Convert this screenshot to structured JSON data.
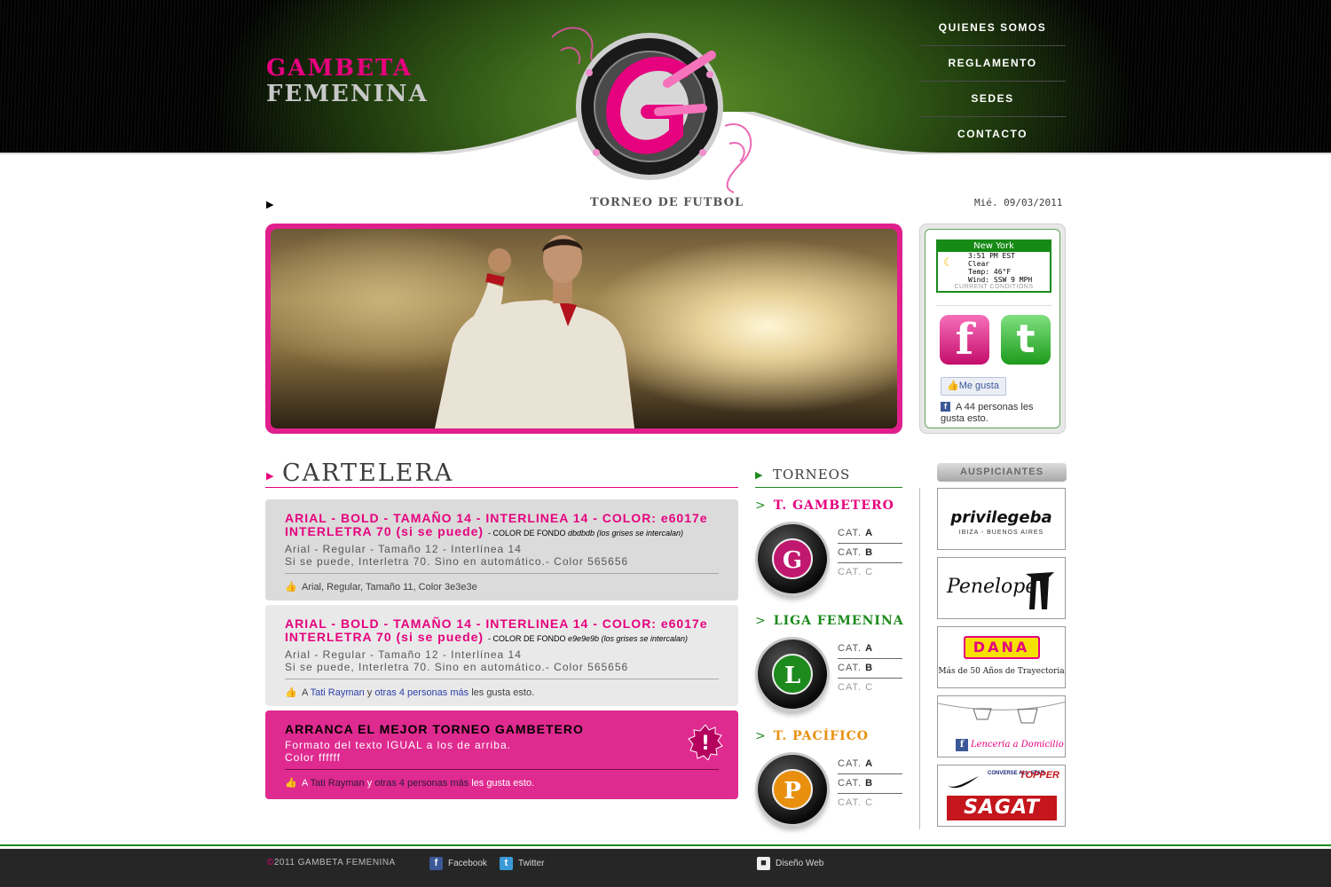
{
  "brand": {
    "line1": "GAMBETA",
    "line2": "FEMENINA"
  },
  "nav": [
    {
      "label": "QUIENES SOMOS"
    },
    {
      "label": "REGLAMENTO"
    },
    {
      "label": "SEDES"
    },
    {
      "label": "CONTACTO"
    }
  ],
  "subheader": {
    "title": "TORNEO DE FUTBOL",
    "date": "Mié. 09/03/2011"
  },
  "weather": {
    "city": "New York",
    "time": "3:51 PM EST",
    "condition": "Clear",
    "temp": "Temp: 46°F",
    "wind": "Wind: SSW 9 MPH",
    "footer": "CURRENT CONDITIONS"
  },
  "social": {
    "facebook_icon": "facebook-icon",
    "twitter_icon": "twitter-icon",
    "like_label": "Me gusta",
    "like_count": "A 44 personas les gusta esto."
  },
  "cartelera": {
    "title": "CARTELERA",
    "cards": [
      {
        "heading": "ARIAL - BOLD - TAMAÑO 14 - INTERLINEA 14 - COLOR: e6017e INTERLETRA 70 (si se puede)",
        "note_prefix": "- COLOR DE FONDO ",
        "note_italic": "dbdbdb (los grises se intercalan)",
        "body1": "Arial - Regular - Tamaño 12 - Interlínea 14",
        "body2": "Si se puede, Interletra 70. Sino en automático.- Color 565656",
        "footer": "Arial, Regular, Tamaño 11, Color 3e3e3e"
      },
      {
        "heading": "ARIAL - BOLD - TAMAÑO 14 - INTERLINEA 14 - COLOR: e6017e INTERLETRA 70 (si se puede)",
        "note_prefix": "- COLOR DE FONDO ",
        "note_italic": "e9e9e9b (los grises se intercalan)",
        "body1": "Arial - Regular - Tamaño 12 - Interlínea 14",
        "body2": "Si se puede, Interletra 70. Sino en automático.- Color 565656",
        "footer_pre": "A ",
        "footer_link1": "Tati Rayman",
        "footer_mid": " y ",
        "footer_link2": "otras 4 personas más",
        "footer_post": " les gusta esto."
      },
      {
        "heading": "ARRANCA EL MEJOR TORNEO GAMBETERO",
        "body1": "Formato del texto IGUAL a los de arriba.",
        "body2": "Color ffffff",
        "footer_pre": "A ",
        "footer_link1": "Tati Rayman",
        "footer_mid": " y ",
        "footer_link2": "otras 4 personas más",
        "footer_post": " les gusta esto."
      }
    ]
  },
  "torneos": {
    "title": "TORNEOS",
    "groups": [
      {
        "arrow": ">",
        "name": "T. GAMBETERO",
        "letter": "G",
        "color": "#c0186e",
        "cats": [
          {
            "pre": "CAT.",
            "val": "A"
          },
          {
            "pre": "CAT.",
            "val": "B"
          },
          {
            "pre": "CAT.",
            "val": "C"
          }
        ]
      },
      {
        "arrow": ">",
        "name": "LIGA FEMENINA",
        "letter": "L",
        "color": "#1d8a1d",
        "cats": [
          {
            "pre": "CAT.",
            "val": "A"
          },
          {
            "pre": "CAT.",
            "val": "B"
          },
          {
            "pre": "CAT.",
            "val": "C"
          }
        ]
      },
      {
        "arrow": ">",
        "name": "T. PACÍFICO",
        "letter": "P",
        "color": "#e8900e",
        "cats": [
          {
            "pre": "CAT.",
            "val": "A"
          },
          {
            "pre": "CAT.",
            "val": "B"
          },
          {
            "pre": "CAT.",
            "val": "C"
          }
        ]
      }
    ]
  },
  "sponsors": {
    "title": "AUSPICIANTES",
    "items": [
      {
        "name": "privilegeba",
        "sub": "IBIZA - BUENOS AIRES"
      },
      {
        "name": "Penelope"
      },
      {
        "name": "DANA",
        "sub": "Más de 50 Años de Trayectoria"
      },
      {
        "name": "Lenceria a Domicilio"
      },
      {
        "name": "SAGAT",
        "brands": [
          "CONVERSE ALL STAR",
          "TOPPER"
        ]
      }
    ]
  },
  "footer": {
    "copyright_symbol": "©",
    "copyright": "2011 GAMBETA FEMENINA",
    "facebook": "Facebook",
    "twitter": "Twitter",
    "design": "Diseño Web"
  }
}
